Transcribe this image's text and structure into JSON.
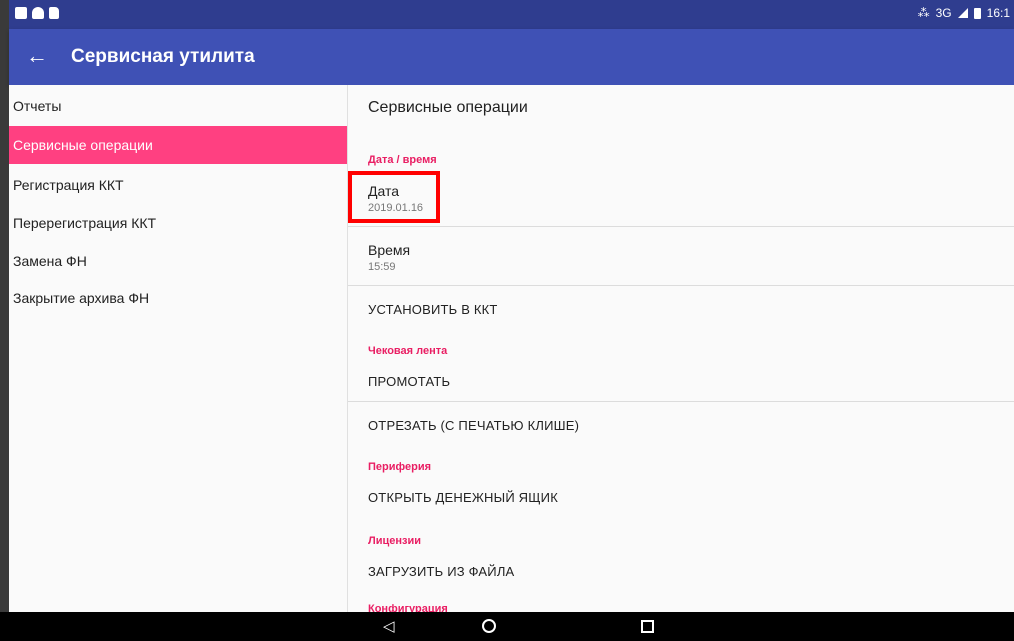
{
  "status_bar": {
    "left_icons": [
      "image-icon",
      "speech-bubble-icon",
      "sd-card-icon"
    ],
    "right_text": "3G",
    "time": "16:1"
  },
  "app_bar": {
    "title": "Сервисная утилита",
    "back_icon": "←"
  },
  "sidebar": {
    "items": [
      {
        "label": "Отчеты"
      },
      {
        "label": "Сервисные операции",
        "selected": true
      },
      {
        "label": "Регистрация ККТ"
      },
      {
        "label": "Перерегистрация ККТ"
      },
      {
        "label": "Замена ФН"
      },
      {
        "label": "Закрытие архива ФН"
      }
    ]
  },
  "content": {
    "title": "Сервисные операции",
    "datetime_section": "Дата / время",
    "date_label": "Дата",
    "date_value": "2019.01.16",
    "time_label": "Время",
    "time_value": "15:59",
    "set_in_kkt": "УСТАНОВИТЬ В ККТ",
    "receipt_section": "Чековая лента",
    "feed": "ПРОМОТАТЬ",
    "cut": "ОТРЕЗАТЬ (С ПЕЧАТЬЮ КЛИШЕ)",
    "periphery_section": "Периферия",
    "open_drawer": "ОТКРЫТЬ ДЕНЕЖНЫЙ ЯЩИК",
    "licenses_section": "Лицензии",
    "load_from_file": "ЗАГРУЗИТЬ ИЗ ФАЙЛА"
  },
  "nav_bar": {
    "back_icon": "◁"
  },
  "colors": {
    "status_bar": "#2f3d8f",
    "app_bar": "#3f51b5",
    "accent": "#ff4081",
    "section_header": "#e91e63",
    "highlight": "#ff0000"
  }
}
